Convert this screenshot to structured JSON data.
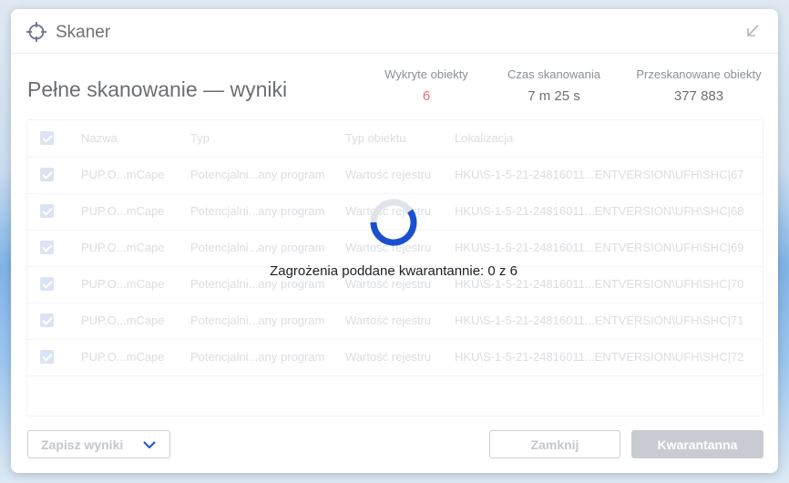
{
  "app": {
    "title": "Skaner"
  },
  "header": {
    "page_title": "Pełne skanowanie — wyniki"
  },
  "stats": {
    "detected_label": "Wykryte obiekty",
    "detected_value": "6",
    "time_label": "Czas skanowania",
    "time_value": "7 m 25 s",
    "scanned_label": "Przeskanowane obiekty",
    "scanned_value": "377 883"
  },
  "table": {
    "columns": [
      "Nazwa",
      "Typ",
      "Typ obiektu",
      "Lokalizacja"
    ],
    "rows": [
      {
        "name": "PUP.O...mCape",
        "type": "Potencjalni...any program",
        "object_type": "Wartość rejestru",
        "location": "HKU\\S-1-5-21-24816011...ENTVERSION\\UFH\\SHC|67"
      },
      {
        "name": "PUP.O...mCape",
        "type": "Potencjalni...any program",
        "object_type": "Wartość rejestru",
        "location": "HKU\\S-1-5-21-24816011...ENTVERSION\\UFH\\SHC|68"
      },
      {
        "name": "PUP.O...mCape",
        "type": "Potencjalni...any program",
        "object_type": "Wartość rejestru",
        "location": "HKU\\S-1-5-21-24816011...ENTVERSION\\UFH\\SHC|69"
      },
      {
        "name": "PUP.O...mCape",
        "type": "Potencjalni...any program",
        "object_type": "Wartość rejestru",
        "location": "HKU\\S-1-5-21-24816011...ENTVERSION\\UFH\\SHC|70"
      },
      {
        "name": "PUP.O...mCape",
        "type": "Potencjalni...any program",
        "object_type": "Wartość rejestru",
        "location": "HKU\\S-1-5-21-24816011...ENTVERSION\\UFH\\SHC|71"
      },
      {
        "name": "PUP.O...mCape",
        "type": "Potencjalni...any program",
        "object_type": "Wartość rejestru",
        "location": "HKU\\S-1-5-21-24816011...ENTVERSION\\UFH\\SHC|72"
      }
    ]
  },
  "progress": {
    "text": "Zagrożenia poddane kwarantannie: 0 z 6"
  },
  "footer": {
    "save_label": "Zapisz wyniki",
    "close_label": "Zamknij",
    "quarantine_label": "Kwarantanna"
  },
  "colors": {
    "accent": "#1a4fd0",
    "alert": "#d0262d",
    "disabled_button": "#c8ccd2"
  },
  "icons": {
    "app": "crosshair-icon",
    "shrink": "arrow-down-left-icon",
    "dropdown": "chevron-down-icon",
    "spinner": "loading-spinner-icon"
  }
}
